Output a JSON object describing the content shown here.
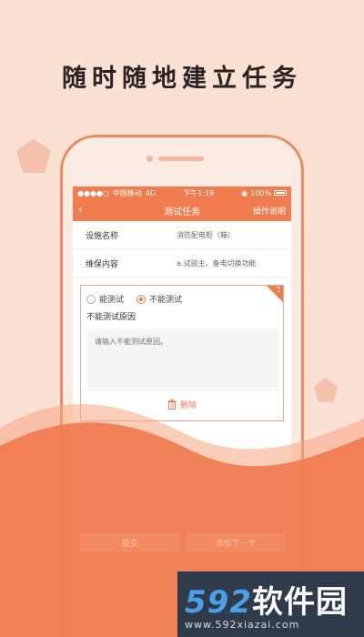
{
  "headline": "随时随地建立任务",
  "status_bar": {
    "carrier": "中国移动",
    "network": "4G",
    "time": "下午1:19",
    "battery": "100%"
  },
  "nav": {
    "back_icon": "chevron-left-icon",
    "title": "测试任务",
    "help": "操作说明"
  },
  "info_rows": [
    {
      "label": "设施名称",
      "value": "消防配电柜（箱）"
    },
    {
      "label": "维保内容",
      "value": "a.试验主、备电切换功能"
    }
  ],
  "test_card": {
    "index": "1",
    "options": [
      {
        "label": "能测试",
        "selected": false
      },
      {
        "label": "不能测试",
        "selected": true
      }
    ],
    "reason_title": "不能测试原因",
    "reason_placeholder": "请输入不能测试原因。",
    "delete_label": "删除"
  },
  "buttons": {
    "submit": "提交",
    "add_next": "添加下一个"
  },
  "watermark": {
    "number": "592",
    "name": "软件园",
    "url": "www.592xiazai.com"
  },
  "colors": {
    "accent": "#f07b4f",
    "background": "#fbe0d4"
  }
}
